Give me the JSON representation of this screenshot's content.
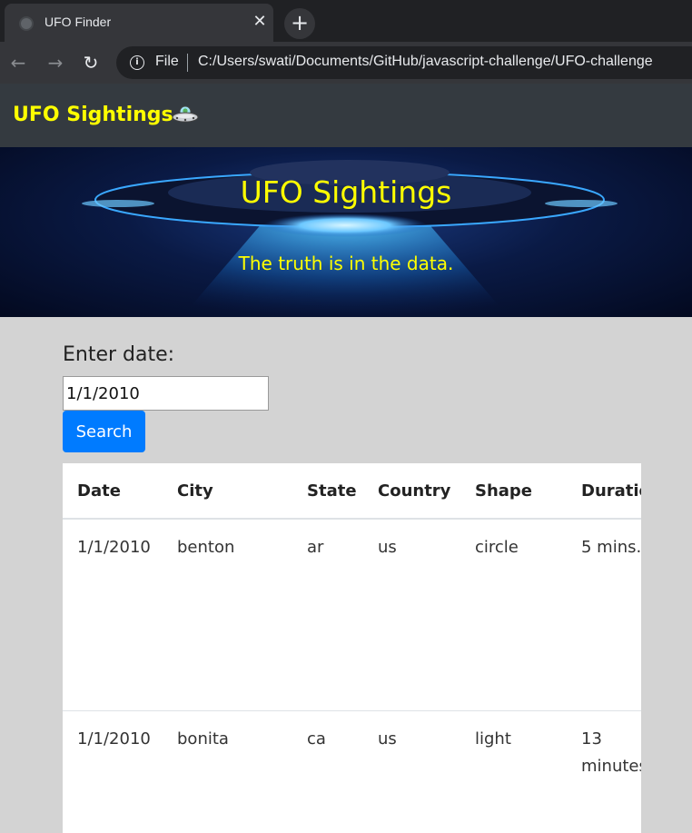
{
  "browser": {
    "tab_title": "UFO Finder",
    "close_glyph": "✕",
    "new_tab_glyph": "+",
    "back_glyph": "←",
    "forward_glyph": "→",
    "reload_glyph": "↻",
    "info_glyph": "i",
    "scheme": "File",
    "url": "C:/Users/swati/Documents/GitHub/javascript-challenge/UFO-challenge"
  },
  "navbar": {
    "brand": "UFO Sightings"
  },
  "hero": {
    "title": "UFO Sightings",
    "subtitle": "The truth is in the data."
  },
  "form": {
    "label": "Enter date:",
    "date_value": "1/1/2010",
    "search_label": "Search"
  },
  "table": {
    "headers": [
      "Date",
      "City",
      "State",
      "Country",
      "Shape",
      "Duration"
    ],
    "rows": [
      [
        "1/1/2010",
        "benton",
        "ar",
        "us",
        "circle",
        "5 mins."
      ],
      [
        "1/1/2010",
        "bonita",
        "ca",
        "us",
        "light",
        "13",
        "minutes"
      ]
    ]
  },
  "colors": {
    "brand_yellow": "#ffff00",
    "navbar_bg": "#343a40",
    "button_blue": "#007bff",
    "page_bg": "#d3d3d3"
  }
}
